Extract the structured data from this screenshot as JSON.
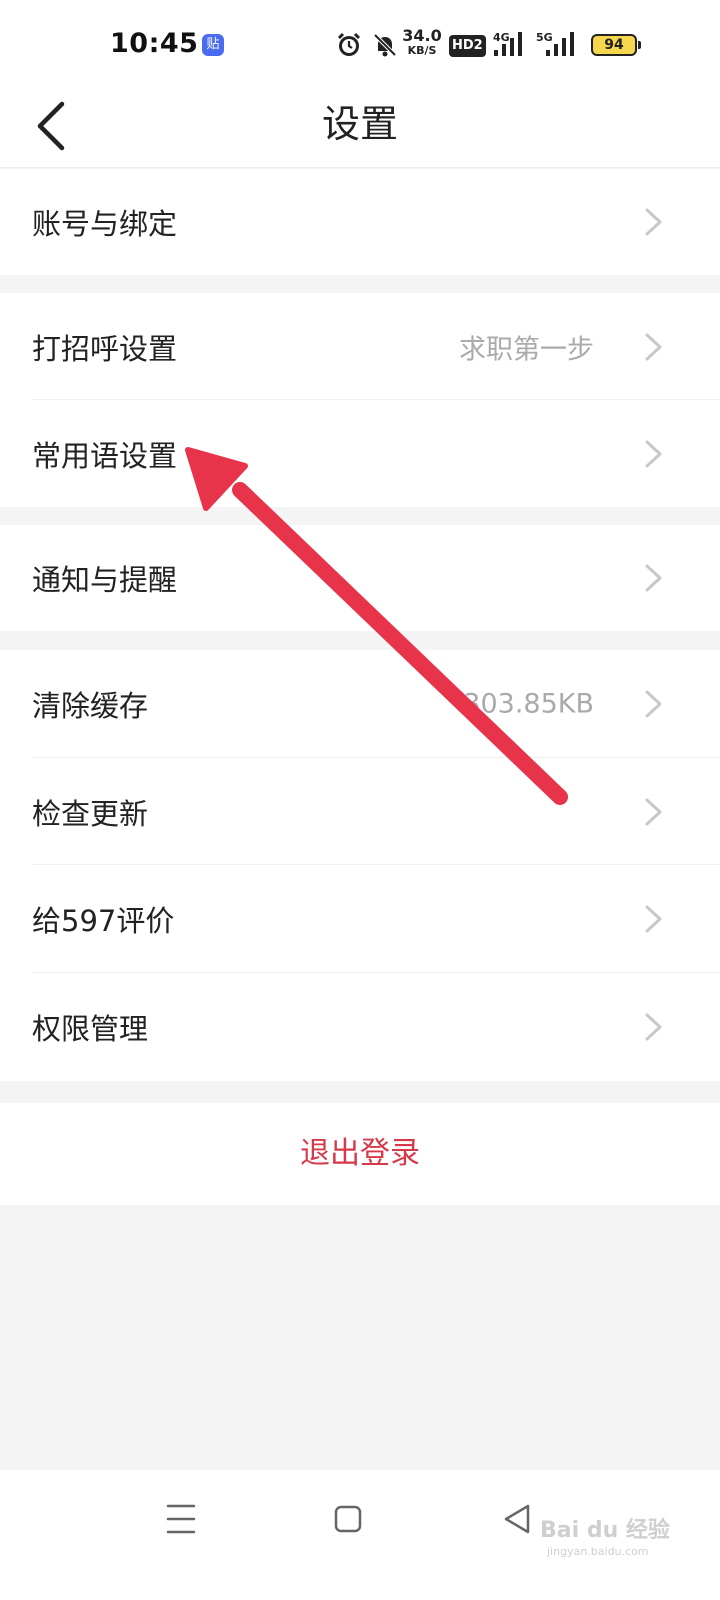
{
  "status_bar": {
    "time": "10:45",
    "app_badge": "贴",
    "net_speed": "34.0",
    "net_speed_unit": "KB/S",
    "hd_label": "HD2",
    "signal1_label": "4G",
    "signal2_label": "5G",
    "battery": "94",
    "icons": [
      "alarm-icon",
      "mute-icon",
      "signal-icon",
      "battery-icon"
    ]
  },
  "header": {
    "title": "设置",
    "back_icon": "chevron-left-icon"
  },
  "settings": {
    "account": {
      "label": "账号与绑定"
    },
    "greeting": {
      "label": "打招呼设置",
      "value": "求职第一步"
    },
    "phrases": {
      "label": "常用语设置"
    },
    "notify": {
      "label": "通知与提醒"
    },
    "cache": {
      "label": "清除缓存",
      "value": "303.85KB"
    },
    "update": {
      "label": "检查更新"
    },
    "rate": {
      "label": "给597评价"
    },
    "permission": {
      "label": "权限管理"
    }
  },
  "logout": {
    "label": "退出登录"
  },
  "annotation": {
    "color": "#e8344a"
  },
  "colors": {
    "accent": "#d6394a",
    "chevron": "#c8c8c8",
    "muted": "#aaaaaa"
  },
  "nav": {
    "icons": [
      "menu-icon",
      "home-icon",
      "back-triangle-icon"
    ]
  },
  "watermark": {
    "text": "Bai du 经验",
    "sub": "jingyan.baidu.com"
  }
}
